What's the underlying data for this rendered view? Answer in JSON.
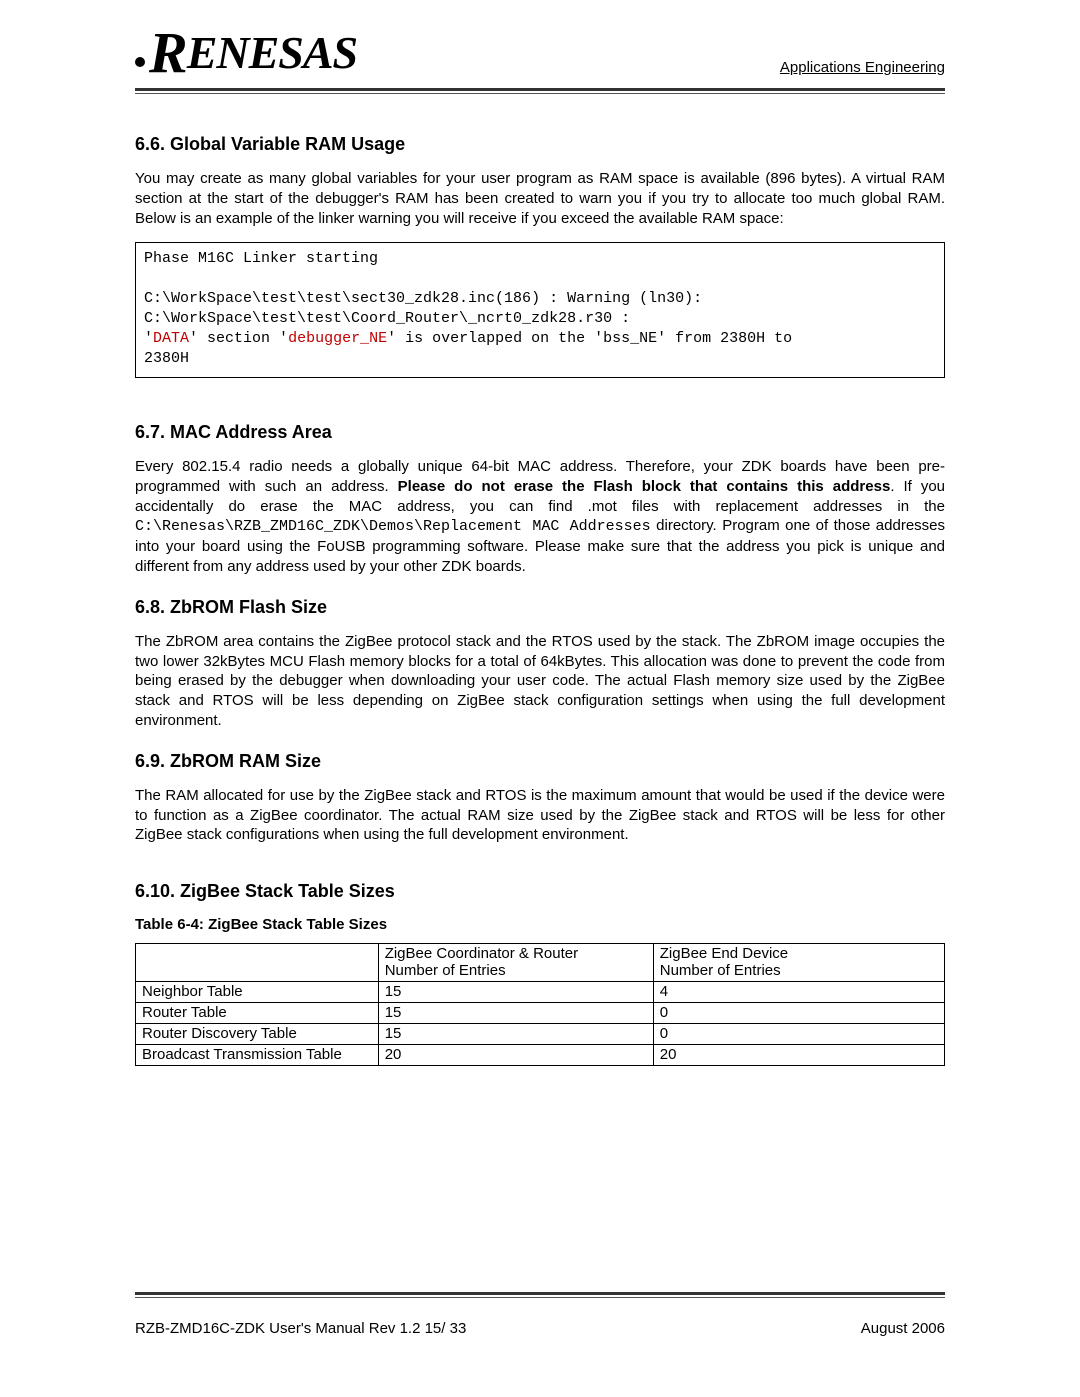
{
  "header": {
    "logo_text_big": "R",
    "logo_text_rest": "ENESAS",
    "right": "Applications Engineering"
  },
  "s66": {
    "title": "6.6. Global Variable RAM Usage",
    "para": "You may create as many global variables for your user program as RAM space is available (896 bytes). A virtual RAM section at the start of the debugger's RAM has been created to warn you if you try to allocate too much global RAM. Below is an example of the linker warning you will receive if you exceed the available RAM space:"
  },
  "code": {
    "l1": "Phase M16C Linker starting",
    "l2": "",
    "l3": "C:\\WorkSpace\\test\\test\\sect30_zdk28.inc(186) : Warning (ln30):",
    "l4": "C:\\WorkSpace\\test\\test\\Coord_Router\\_ncrt0_zdk28.r30 :",
    "l5a": "'",
    "l5b": "DATA",
    "l5c": "' section '",
    "l5d": "debugger_NE",
    "l5e": "' is overlapped on the 'bss_NE' from 2380H to",
    "l6": "2380H"
  },
  "s67": {
    "title": "6.7. MAC Address Area",
    "p1a": "Every 802.15.4 radio needs a globally unique 64-bit MAC address. Therefore, your ZDK boards have been pre-programmed with such an address. ",
    "p1b": "Please do not erase the Flash block that contains this address",
    "p1c": ". If you accidentally do erase the MAC address, you can find .mot files with replacement addresses in the ",
    "p1d": "C:\\Renesas\\RZB_ZMD16C_ZDK\\Demos\\Replacement MAC Addresses",
    "p1e": " directory. Program one of those addresses into your board using the FoUSB programming software. Please make sure that the address you pick is unique and different from any address used by your other ZDK boards."
  },
  "s68": {
    "title": "6.8. ZbROM Flash Size",
    "para": "The ZbROM area contains the ZigBee protocol stack and the RTOS used by the stack. The ZbROM image occupies the two lower 32kBytes MCU Flash memory blocks for a total of 64kBytes. This allocation was done to prevent the code from being erased by the debugger when downloading your user code. The actual Flash memory size used by the ZigBee stack and RTOS will be less depending on ZigBee stack configuration settings when using the full development environment."
  },
  "s69": {
    "title": "6.9. ZbROM RAM Size",
    "para": "The RAM allocated for use by the ZigBee stack and RTOS is the maximum amount that would be used if the device were to function as a ZigBee coordinator. The actual RAM size used by the ZigBee stack and RTOS will be less for other ZigBee stack configurations when using the full development environment."
  },
  "s610": {
    "title": "6.10. ZigBee Stack Table Sizes",
    "caption": "Table 6-4: ZigBee Stack Table Sizes",
    "head": {
      "c2a": "ZigBee Coordinator & Router",
      "c2b": "Number of Entries",
      "c3a": "ZigBee End Device",
      "c3b": "Number of Entries"
    },
    "rows": [
      {
        "name": "Neighbor Table",
        "coord": "15",
        "end": "4"
      },
      {
        "name": "Router Table",
        "coord": "15",
        "end": "0"
      },
      {
        "name": "Router Discovery Table",
        "coord": "15",
        "end": "0"
      },
      {
        "name": "Broadcast Transmission Table",
        "coord": "20",
        "end": "20"
      }
    ]
  },
  "footer": {
    "left": "RZB-ZMD16C-ZDK User's Manual Rev 1.2    15/ 33",
    "right": "August 2006"
  }
}
